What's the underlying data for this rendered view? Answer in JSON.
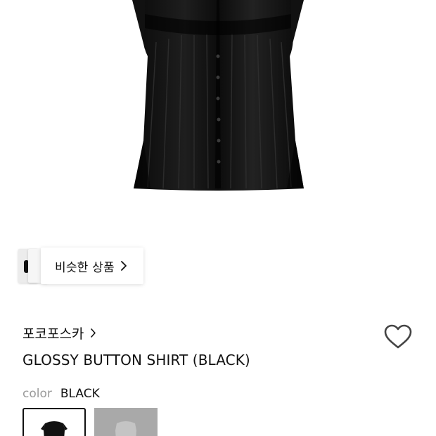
{
  "similar": {
    "label": "비슷한 상품"
  },
  "product": {
    "brand": "포코포스카",
    "title": "GLOSSY BUTTON SHIRT (BLACK)",
    "color_label": "color",
    "color_value": "BLACK"
  },
  "icons": {
    "similar_chevron": "chevron-right-icon",
    "brand_chevron": "chevron-right-icon",
    "wishlist": "heart-outline-icon"
  },
  "colors": {
    "text": "#111111",
    "muted": "#9a9a9a",
    "swatch_selected_border": "#111111",
    "swatch_gray": "#a9a9a9"
  }
}
